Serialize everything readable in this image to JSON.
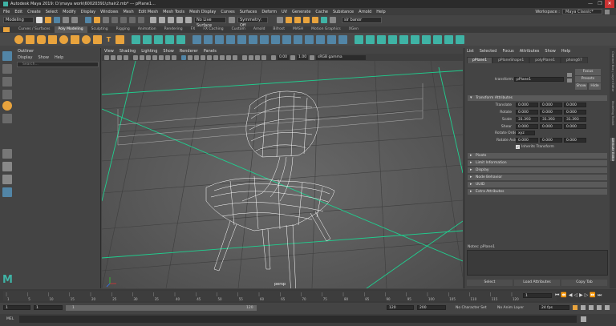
{
  "title": "Autodesk Maya 2019: D:\\maya work\\60020391\\chair2.mb* --- pPlane1...",
  "window_controls": [
    "—",
    "❐",
    "✕"
  ],
  "menubar": [
    "File",
    "Edit",
    "Create",
    "Select",
    "Modify",
    "Display",
    "Windows",
    "Mesh",
    "Edit Mesh",
    "Mesh Tools",
    "Mesh Display",
    "Curves",
    "Surfaces",
    "Deform",
    "UV",
    "Generate",
    "Cache",
    "Substance",
    "Arnold",
    "Help"
  ],
  "workspace": {
    "label": "Workspace :",
    "value": "Maya Classic*"
  },
  "statusline": {
    "mode": "Modeling",
    "live_surface": "No Live Surface",
    "symmetry": "Symmetry: Off",
    "camera": "sir banor"
  },
  "shelf_tabs": [
    "Curves / Surfaces",
    "Poly Modeling",
    "Sculpting",
    "Rigging",
    "Animation",
    "Rendering",
    "FX",
    "FX Caching",
    "Custom",
    "Arnold",
    "Bifrost",
    "MASH",
    "Motion Graphics",
    "XGen"
  ],
  "shelf_active": "Poly Modeling",
  "outliner": {
    "title": "Outliner",
    "menu": [
      "Display",
      "Show",
      "Help"
    ],
    "search_placeholder": "Search..."
  },
  "viewport": {
    "menu": [
      "View",
      "Shading",
      "Lighting",
      "Show",
      "Renderer",
      "Panels"
    ],
    "field1": "0.00",
    "field2": "1.00",
    "colorspace": "sRGB gamma",
    "camera_label": "persp"
  },
  "attr_editor": {
    "menu": [
      "List",
      "Selected",
      "Focus",
      "Attributes",
      "Show",
      "Help"
    ],
    "tabs": [
      "pPlane1",
      "pPlaneShape1",
      "polyPlane1",
      "phong67"
    ],
    "active_tab": "pPlane1",
    "transform_label": "transform:",
    "transform_value": "pPlane1",
    "buttons": {
      "focus": "Focus",
      "presets": "Presets",
      "show": "Show",
      "hide": "Hide"
    },
    "section_transform": "Transform Attributes",
    "rows": [
      {
        "label": "Translate",
        "values": [
          "0.000",
          "0.000",
          "0.000"
        ]
      },
      {
        "label": "Rotate",
        "values": [
          "0.000",
          "0.000",
          "0.000"
        ]
      },
      {
        "label": "Scale",
        "values": [
          "31.393",
          "31.393",
          "31.393"
        ]
      },
      {
        "label": "Shear",
        "values": [
          "0.000",
          "0.000",
          "0.000"
        ]
      }
    ],
    "rotate_order": {
      "label": "Rotate Order",
      "value": "xyz"
    },
    "rotate_axis": {
      "label": "Rotate Axis",
      "values": [
        "0.000",
        "0.000",
        "0.000"
      ]
    },
    "inherits": "Inherits Transform",
    "sections": [
      "Pivots",
      "Limit Information",
      "Display",
      "Node Behavior",
      "UUID",
      "Extra Attributes"
    ],
    "notes": "Notes:  pPlane1",
    "bottom_buttons": [
      "Select",
      "Load Attributes",
      "Copy Tab"
    ]
  },
  "side_tabs": [
    "Channel Box / Layer Editor",
    "Modeling Toolkit",
    "Attribute Editor"
  ],
  "side_active": "Attribute Editor",
  "timeslider": {
    "ticks": [
      "1",
      "5",
      "10",
      "15",
      "20",
      "25",
      "30",
      "35",
      "40",
      "45",
      "50",
      "55",
      "60",
      "65",
      "70",
      "75",
      "80",
      "85",
      "90",
      "95",
      "100",
      "105",
      "110",
      "115",
      "120"
    ],
    "current": "1"
  },
  "range": {
    "start": "1",
    "start2": "1",
    "slider_start": "1",
    "slider_end": "120",
    "end": "120",
    "end2": "200",
    "character": "No Character Set",
    "anim_layer": "No Anim Layer",
    "fps": "24 fps"
  },
  "cmdline": {
    "label": "MEL"
  },
  "colors": {
    "accent_orange": "#e8a33d",
    "accent_teal": "#3fb3a5",
    "selected_blue": "#5285a6",
    "grid_green": "#1fcf8f",
    "wire_white": "#ffffff"
  }
}
